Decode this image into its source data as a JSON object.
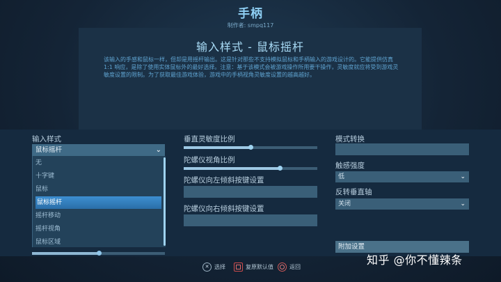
{
  "header": {
    "title": "手柄",
    "author": "制作者: smpq117"
  },
  "description": {
    "title": "输入样式 - 鼠标摇杆",
    "text": "该输入的手感和鼠标一样，但却是用摇杆输出。这是针对那些不支持模拟鼠标和手柄输入的游戏设计的。它能提供仿真 1:1 响应，是除了使用实体鼠标外的最好选择。注意：基于该模式会被游戏操作所用要干操作，灵敏度就应将受到游戏灵敏度设置的限制。为了获取最佳游戏体验，游戏中的手柄视角灵敏度设置的越高越好。"
  },
  "left": {
    "label": "输入样式",
    "selected": "鼠标摇杆",
    "options": [
      "无",
      "十字键",
      "鼠标",
      "鼠标摇杆",
      "摇杆移动",
      "摇杆视角",
      "鼠标区域"
    ],
    "selected_index": 3,
    "bottom_slider_value": 0.5
  },
  "middle": {
    "vertical_ratio_label": "垂直灵敏度比例",
    "vertical_ratio_value": 0.5,
    "gyro_angle_label": "陀螺仪视角比例",
    "gyro_angle_value": 0.72,
    "tilt_left_label": "陀螺仪向左倾斜按键设置",
    "tilt_right_label": "陀螺仪向右倾斜按键设置"
  },
  "right": {
    "mode_switch_label": "模式转换",
    "haptic_label": "触感强度",
    "haptic_value": "低",
    "invert_label": "反转垂直轴",
    "invert_value": "关闭",
    "extra_button": "附加设置"
  },
  "footer": {
    "select": "选择",
    "restore": "复原默认值",
    "back": "返回",
    "select_icon": "✕"
  },
  "watermark": "知乎 @你不懂辣条"
}
